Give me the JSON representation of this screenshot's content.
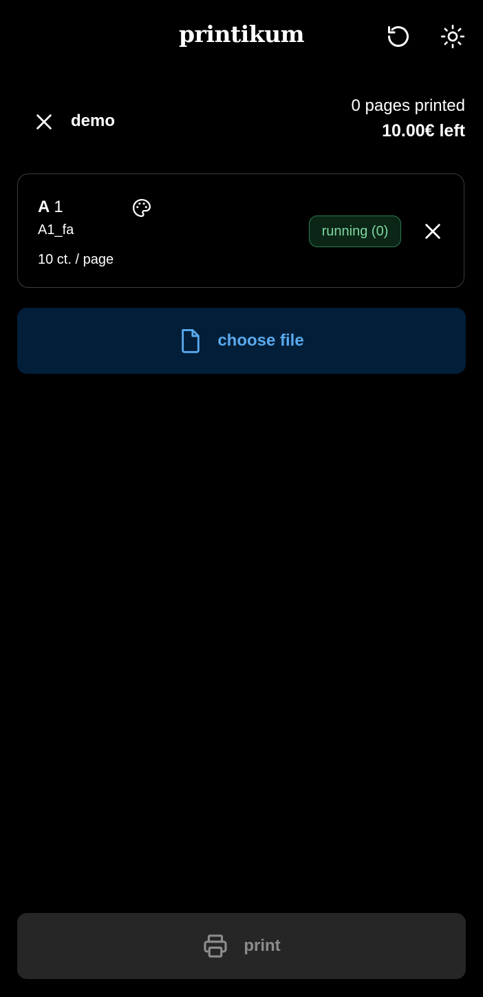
{
  "header": {
    "title": "printikum",
    "reload_icon": "reload-icon",
    "theme_icon": "sun-icon"
  },
  "account": {
    "name": "demo",
    "pages_printed": "0 pages printed",
    "balance": "10.00€ left"
  },
  "printer": {
    "letter": "A",
    "number": "1",
    "queue": "A1_fa",
    "price": "10 ct. / page",
    "status": "running (0)",
    "status_color": "#7fd79e",
    "color_icon": "palette-icon"
  },
  "actions": {
    "choose_file_label": "choose file",
    "choose_file_color": "#5aa9ee",
    "print_label": "print"
  }
}
